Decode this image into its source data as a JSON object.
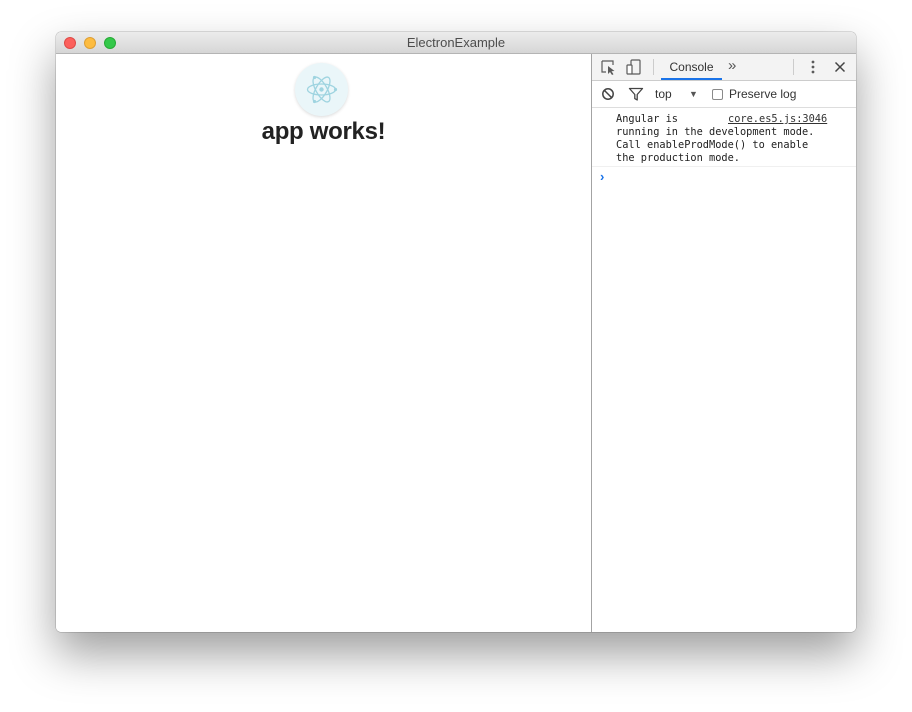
{
  "window": {
    "title": "ElectronExample"
  },
  "app": {
    "heading": "app works!",
    "logo_icon": "electron-atom-icon"
  },
  "devtools": {
    "toolbar": {
      "inspect_icon": "inspect-element-icon",
      "device_icon": "device-toolbar-icon",
      "active_tab": "Console",
      "more_tabs": "»",
      "menu_icon": "kebab-menu-icon",
      "close_icon": "close-icon"
    },
    "filter": {
      "clear_icon": "clear-console-icon",
      "filter_icon": "filter-icon",
      "context": "top",
      "context_arrow": "▼",
      "preserve_log_label": "Preserve log",
      "preserve_log_checked": false
    },
    "messages": [
      {
        "source": "core.es5.js:3046",
        "lines": [
          "Angular is",
          "running in the development mode.",
          "Call enableProdMode() to enable",
          "the production mode."
        ]
      }
    ],
    "prompt": {
      "caret": "›",
      "value": ""
    }
  },
  "colors": {
    "accent": "#1a73e8",
    "traffic_close": "#fc605c",
    "traffic_minimize": "#fdbc40",
    "traffic_maximize": "#34c84a",
    "logo_bg": "#eaf6f9",
    "logo_stroke": "#9fd4e0"
  }
}
